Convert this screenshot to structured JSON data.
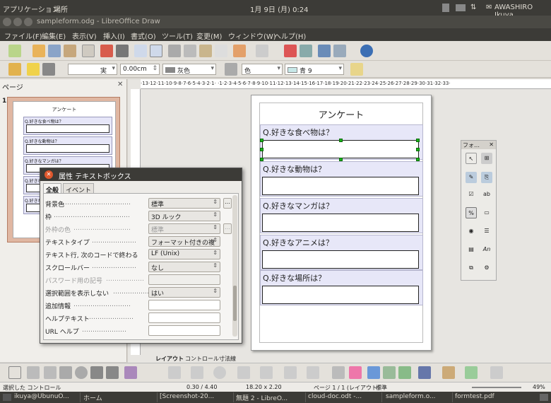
{
  "top_panel": {
    "applications": "アプリケーション",
    "places": "場所",
    "clock": "1月 9日 (月) 0:24",
    "user": "AWASHIRO Ikuya"
  },
  "window": {
    "title": "sampleform.odg - LibreOffice Draw"
  },
  "menu": [
    "ファイル(F)",
    "編集(E)",
    "表示(V)",
    "挿入(I)",
    "書式(O)",
    "ツール(T)",
    "変更(M)",
    "ウィンドウ(W)",
    "ヘルプ(H)"
  ],
  "format_bar": {
    "line_width": "0.00cm",
    "area_style": "灰色",
    "fill_type": "色",
    "fill_color": "青 9",
    "line_style_label": "実"
  },
  "pages_pane": {
    "title": "ページ",
    "page_number": "1"
  },
  "thumbnail": {
    "title": "アンケート",
    "items": [
      "Q.好きな食べ物は？",
      "Q.好きな動物は？",
      "Q.好きなマンガは？",
      "Q.好きなアニメは？",
      "Q.好きな場所は？"
    ]
  },
  "ruler": {
    "text": "·13·12·11·10·9·8·7·6·5·4·3·2·1·  ·1·2·3·4·5·6·7·8·9·10·11·12·13·14·15·16·17·18·19·20·21·22·23·24·25·26·27·28·29·30·31·32·33·"
  },
  "survey": {
    "title": "アンケート",
    "questions": [
      "Q.好きな食べ物は？",
      "Q.好きな動物は？",
      "Q.好きなマンガは？",
      "Q.好きなアニメは？",
      "Q.好きな場所は？"
    ]
  },
  "sheet_tabs": [
    "レイアウト",
    "コントロール",
    "寸法線"
  ],
  "dialog": {
    "title": "属性 テキストボックス",
    "tabs": [
      "全般",
      "イベント"
    ],
    "rows": [
      {
        "label": "背景色",
        "value": "標準"
      },
      {
        "label": "枠",
        "value": "3D ルック"
      },
      {
        "label": "外枠の色",
        "value": "標準"
      },
      {
        "label": "テキストタイプ",
        "value": "フォーマット付きの複"
      },
      {
        "label": "テキスト行, 次のコードで終わる",
        "value": "LF (Unix)"
      },
      {
        "label": "スクロールバー",
        "value": "なし"
      },
      {
        "label": "パスワード用の記号",
        "value": ""
      },
      {
        "label": "選択範囲を表示しない",
        "value": "はい"
      },
      {
        "label": "追加情報",
        "value": ""
      },
      {
        "label": "ヘルプテキスト",
        "value": ""
      },
      {
        "label": "URL ヘルプ",
        "value": ""
      }
    ]
  },
  "palette": {
    "title": "フォ…"
  },
  "status": {
    "selection": "選択した コントロール",
    "position": "0.30 / 4.40",
    "size": "18.20 x 2.20",
    "page": "ページ 1 / 1 (レイアウト)",
    "layout": "標準",
    "zoom": "49%"
  },
  "taskbar": [
    "ikuya@UbunuO...",
    "ホーム",
    "[Screenshot-20...",
    "無題 2 - LibreO...",
    "cloud-doc.odt -...",
    "sampleform.o...",
    "formtest.pdf"
  ],
  "colors": {
    "accent_selection": "#19b419",
    "form_section": "#e7e7f8",
    "panel_dark": "#3c3b37",
    "slide_highlight": "#e0b7a2"
  }
}
